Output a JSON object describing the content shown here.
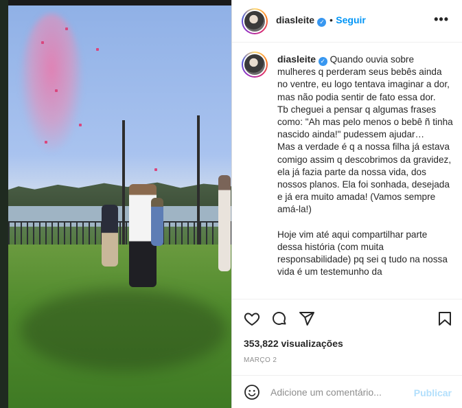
{
  "media": {
    "kind": "video-frame"
  },
  "header": {
    "username": "diasleite",
    "verified_icon": "verified-badge-icon",
    "separator": "•",
    "follow_label": "Seguir",
    "more_icon": "more-options-icon",
    "more_label": "•••"
  },
  "post": {
    "username": "diasleite",
    "caption": "Quando ouvia sobre mulheres q perderam seus bebês ainda no ventre, eu logo tentava imaginar a dor, mas não podia sentir de fato essa dor.\nTb cheguei a pensar q algumas frases como: \"Ah mas pelo menos o bebê ñ tinha nascido ainda!\" pudessem ajudar…\nMas a verdade é q a nossa filha já estava comigo assim q descobrimos da gravidez, ela já fazia parte da nossa vida, dos nossos planos. Ela foi sonhada, desejada e já era muito amada! (Vamos sempre amá-la!)\n\nHoje vim até aqui compartilhar parte dessa história (com muita responsabilidade) pq sei q tudo na nossa vida é um testemunho da"
  },
  "actions": {
    "like_icon": "heart-icon",
    "comment_icon": "comment-icon",
    "share_icon": "share-icon",
    "save_icon": "bookmark-icon",
    "views_count": "353,822",
    "views_label": "visualizações",
    "date": "MARÇO 2"
  },
  "comment": {
    "emoji_icon": "emoji-icon",
    "placeholder": "Adicione um comentário...",
    "publish_label": "Publicar"
  },
  "colors": {
    "accent": "#0095f6",
    "publish_disabled": "#b2dffc",
    "verified": "#3897f0",
    "text": "#262626",
    "muted": "#8e8e8e"
  }
}
